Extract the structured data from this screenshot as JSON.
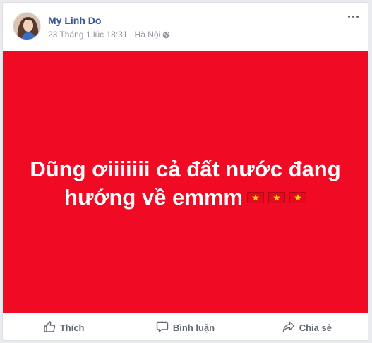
{
  "post": {
    "author": "My Linh Do",
    "date": "23 Tháng 1 lúc 18:31",
    "separator": "·",
    "location": "Hà Nội",
    "privacy_icon": "globe-icon",
    "text_line1": "Dũng ơiiiiiii cả đất nước đang",
    "text_line2": "hướng về emmm",
    "flag_count": 3,
    "background_color": "#f00a24"
  },
  "actions": {
    "like_label": "Thích",
    "comment_label": "Bình luận",
    "share_label": "Chia sẻ"
  }
}
